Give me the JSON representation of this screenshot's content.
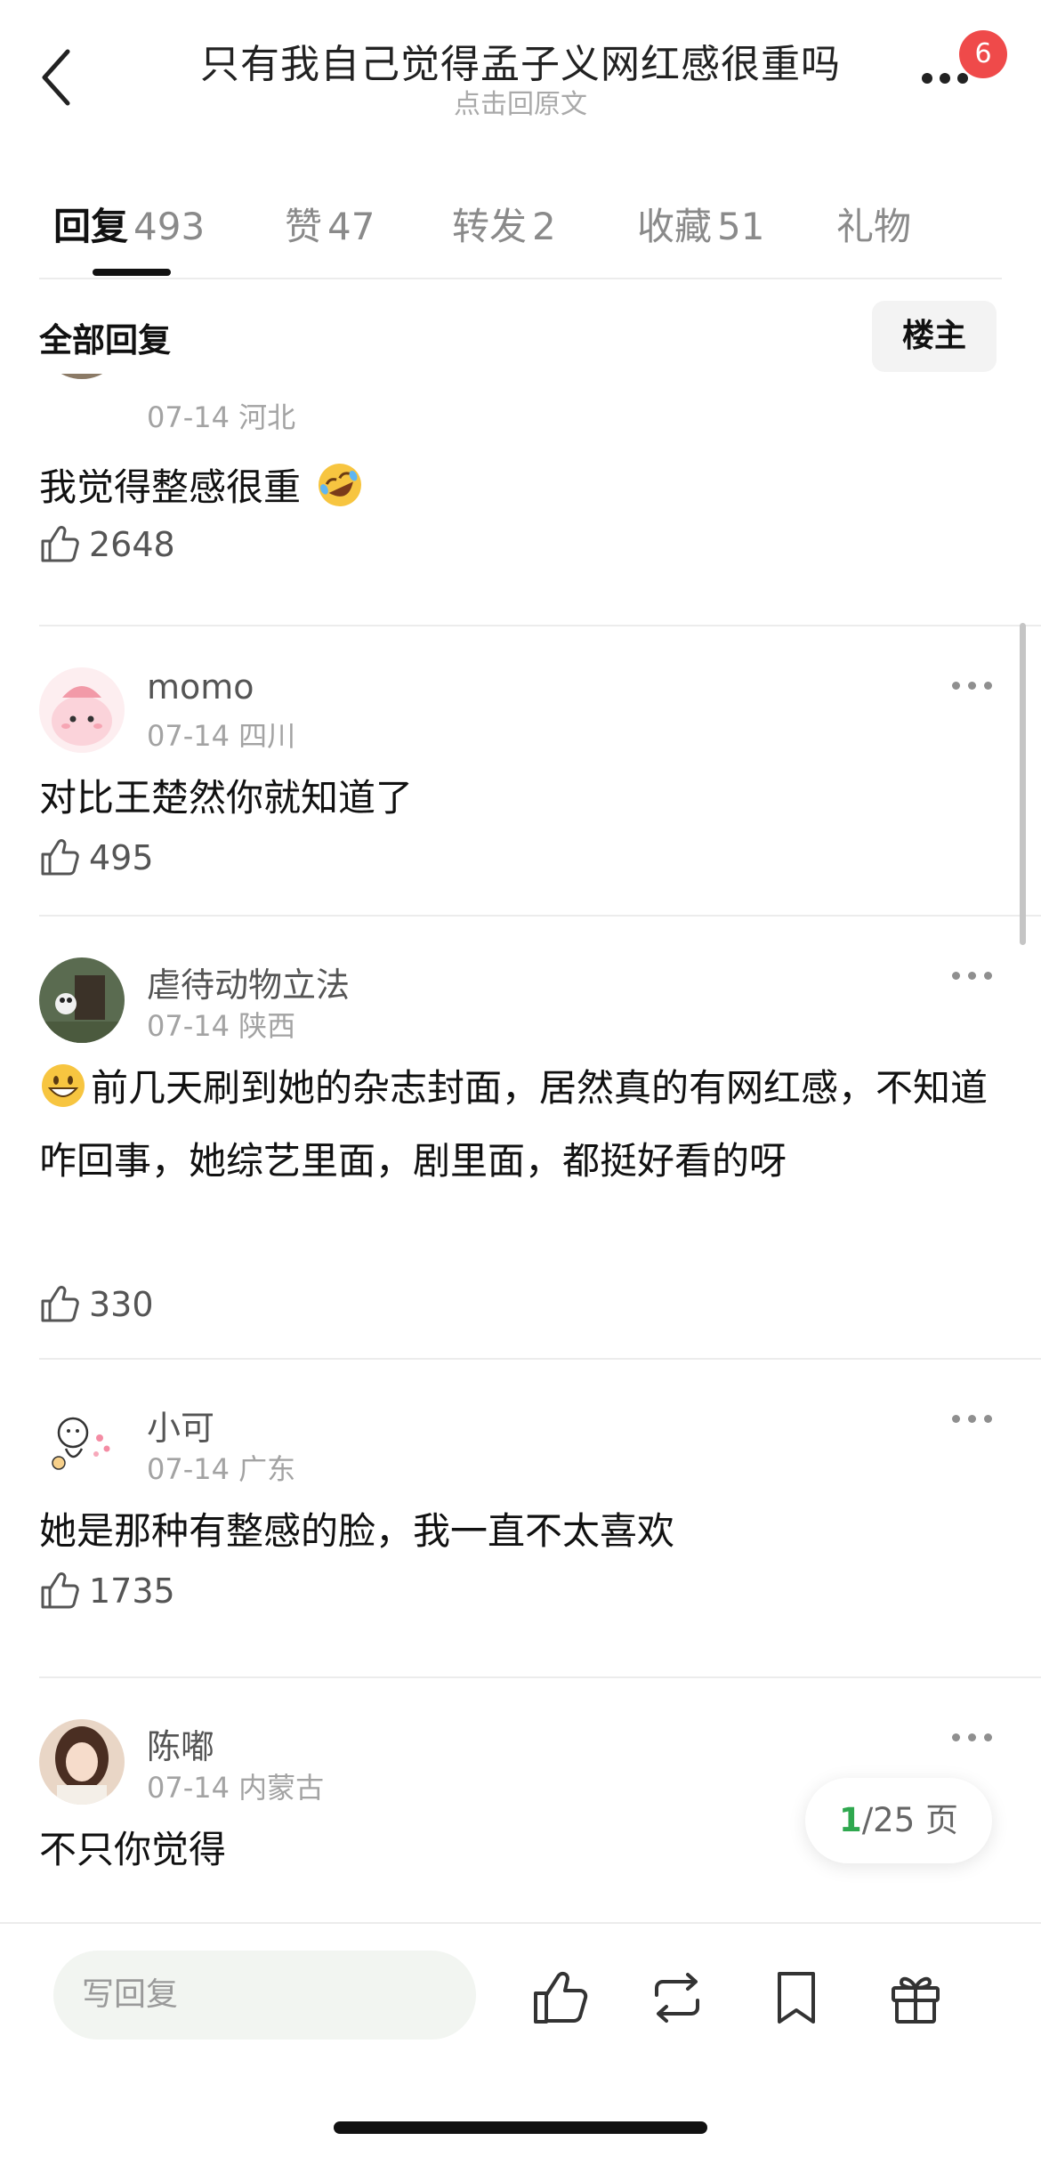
{
  "header": {
    "title": "只有我自己觉得孟子义网红感很重吗",
    "subtitle": "点击回原文",
    "notification_count": "6"
  },
  "tabs": [
    {
      "label": "回复",
      "count": "493",
      "active": true
    },
    {
      "label": "赞",
      "count": "47"
    },
    {
      "label": "转发",
      "count": "2"
    },
    {
      "label": "收藏",
      "count": "51"
    },
    {
      "label": "礼物",
      "count": ""
    }
  ],
  "filter": {
    "label": "全部回复",
    "owner_button": "楼主"
  },
  "comments": [
    {
      "username": "",
      "date": "07-14",
      "location": "河北",
      "text": "我觉得整感很重",
      "emoji": "rofl",
      "likes": "2648"
    },
    {
      "username": "momo",
      "date": "07-14",
      "location": "四川",
      "text": "对比王楚然你就知道了",
      "likes": "495"
    },
    {
      "username": "虐待动物立法",
      "date": "07-14",
      "location": "陕西",
      "emoji_lead": "grin",
      "text": "前几天刷到她的杂志封面，居然真的有网红感，不知道咋回事，她综艺里面，剧里面，都挺好看的呀",
      "likes": "330"
    },
    {
      "username": "小可",
      "date": "07-14",
      "location": "广东",
      "text": "她是那种有整感的脸，我一直不太喜欢",
      "likes": "1735"
    },
    {
      "username": "陈嘟",
      "date": "07-14",
      "location": "内蒙古",
      "text": "不只你觉得"
    }
  ],
  "pager": {
    "current": "1",
    "total": "/25 页"
  },
  "bottom_bar": {
    "reply_placeholder": "写回复",
    "icons": [
      "thumbs-up-icon",
      "repost-icon",
      "bookmark-icon",
      "gift-icon"
    ]
  },
  "colors": {
    "accent_green": "#2fa84f",
    "badge_red": "#ef4a4a"
  }
}
